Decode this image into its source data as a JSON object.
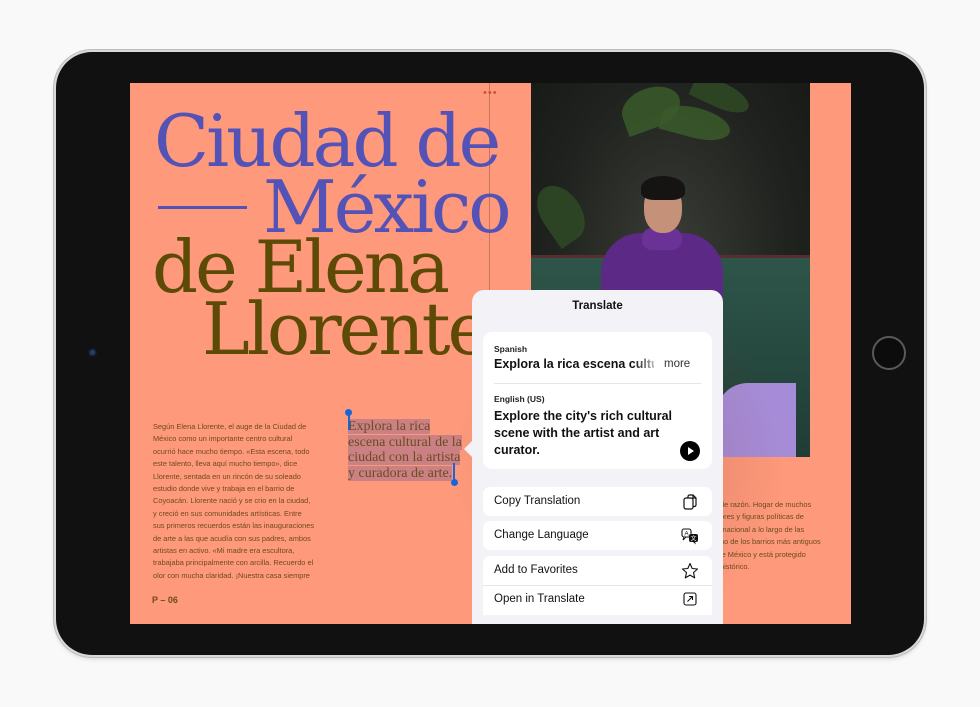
{
  "article": {
    "title_line1": "Ciudad de",
    "title_line2": "México",
    "title_line3": "de Elena",
    "title_line4": "Llorente",
    "body": "Según Elena Llorente, el auge de la Ciudad de México como un importante centro cultural ocurrió hace mucho tiempo. «Esta escena, todo este talento, lleva aquí mucho tiempo», dice Llorente, sentada en un rincón de su soleado estudio donde vive y trabaja en el barrio de Coyoacán. Llorente nació y se crio en la ciudad, y creció en sus comunidades artísticas. Entre sus primeros recuerdos están las inauguraciones de arte a las que acudía con sus padres, ambos artistas en activo. «Mi madre era escultora, trabajaba principalmente con arcilla. Recuerdo el olor con mucha claridad. ¡Nuestra casa siempre",
    "pull_quote": "Explora la rica escena cultural de la ciudad con la artista y curadora de arte.",
    "page_number": "P – 06",
    "page_dots": "•••",
    "right_column_lines": [
      "de razón. Hogar de muchos",
      "ores y figuras políticas de",
      "rnacional a lo largo de las",
      "no de los barrios más antiguos",
      "le México y está protegido",
      "histórico."
    ]
  },
  "translate_popup": {
    "title": "Translate",
    "source_language": "Spanish",
    "source_text": "Explora la rica escena cultural",
    "more_label": "more",
    "target_language": "English (US)",
    "target_text": "Explore the city's rich cultural scene with the artist and art curator.",
    "actions": [
      {
        "label": "Copy Translation",
        "icon": "copy-icon"
      },
      {
        "label": "Change Language",
        "icon": "translate-language-icon"
      },
      {
        "label": "Add to Favorites",
        "icon": "star-icon"
      },
      {
        "label": "Open in Translate",
        "icon": "open-external-icon"
      }
    ]
  },
  "colors": {
    "page_background": "#fe997b",
    "title_blue": "#5352b7",
    "title_brown": "#5e4a07",
    "selection_handle": "#1766d9",
    "popup_background": "#f2f2f7"
  }
}
